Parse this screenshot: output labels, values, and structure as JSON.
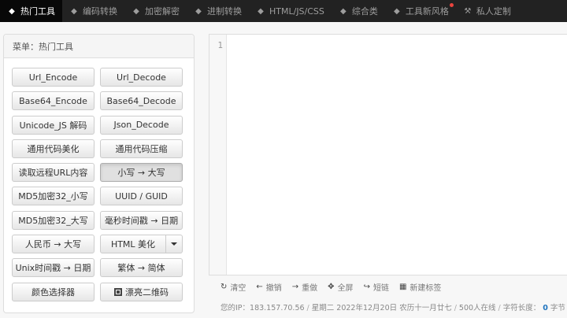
{
  "nav": {
    "items": [
      {
        "label": "热门工具",
        "icon": "tag-icon",
        "active": true
      },
      {
        "label": "编码转换",
        "icon": "tag-icon"
      },
      {
        "label": "加密解密",
        "icon": "tag-icon"
      },
      {
        "label": "进制转换",
        "icon": "tag-icon"
      },
      {
        "label": "HTML/JS/CSS",
        "icon": "tag-icon"
      },
      {
        "label": "综合类",
        "icon": "tag-icon"
      },
      {
        "label": "工具新风格",
        "icon": "tag-icon",
        "badge": "new-dot"
      },
      {
        "label": "私人定制",
        "icon": "wrench-icon"
      }
    ]
  },
  "sidebar": {
    "title": "菜单：热门工具",
    "rows": [
      [
        "Url_Encode",
        "Url_Decode"
      ],
      [
        "Base64_Encode",
        "Base64_Decode"
      ],
      [
        "Unicode_JS 解码",
        "Json_Decode"
      ],
      [
        "通用代码美化",
        "通用代码压缩"
      ],
      [
        "读取远程URL内容",
        "小写 → 大写"
      ],
      [
        "MD5加密32_小写",
        "UUID / GUID"
      ],
      [
        "MD5加密32_大写",
        "毫秒时间戳 → 日期"
      ],
      [
        "人民币 → 大写",
        "HTML 美化"
      ],
      [
        "Unix时间戳 → 日期",
        "繁体 → 简体"
      ],
      [
        "颜色选择器",
        "漂亮二维码"
      ]
    ],
    "pressed_button": "小写 → 大写"
  },
  "editor": {
    "line_number": "1",
    "content": ""
  },
  "toolbar": {
    "items": [
      {
        "label": "清空",
        "icon": "refresh-icon"
      },
      {
        "label": "撤销",
        "icon": "arrow-left-icon"
      },
      {
        "label": "重做",
        "icon": "arrow-right-icon"
      },
      {
        "label": "全屏",
        "icon": "fullscreen-icon"
      },
      {
        "label": "短链",
        "icon": "share-icon"
      },
      {
        "label": "新建标签",
        "icon": "grid-icon"
      }
    ]
  },
  "status": {
    "ip_label": "您的IP：",
    "ip": "183.157.70.56",
    "weekday": "星期二",
    "date": "2022年12月20日",
    "lunar": "农历十一月廿七",
    "online": "500人在线",
    "length_label": "字符长度：",
    "length": "0",
    "length_unit": "字节"
  },
  "colors": {
    "nav_bg": "#222222",
    "nav_active_bg": "#080808",
    "badge": "#e9443e",
    "count": "#1e73be"
  }
}
